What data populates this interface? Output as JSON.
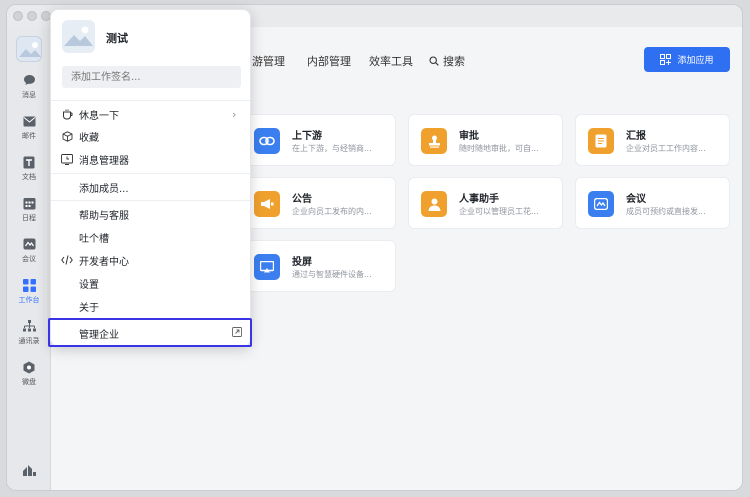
{
  "sidebar": {
    "items": [
      {
        "label": "消息",
        "icon": "chat-icon"
      },
      {
        "label": "邮件",
        "icon": "mail-icon"
      },
      {
        "label": "文档",
        "icon": "doc-icon"
      },
      {
        "label": "日程",
        "icon": "calendar-icon"
      },
      {
        "label": "会议",
        "icon": "meeting-icon"
      },
      {
        "label": "工作台",
        "icon": "workbench-icon"
      },
      {
        "label": "通讯录",
        "icon": "contacts-icon"
      },
      {
        "label": "微盘",
        "icon": "drive-icon"
      }
    ]
  },
  "tabs": {
    "t1": "游管理",
    "t2": "内部管理",
    "t3": "效率工具",
    "t4": "搜索"
  },
  "add_app_label": "添加应用",
  "cards": [
    {
      "title": "上下游",
      "desc": "在上下游，与经销商...",
      "color": "#3a7ef0"
    },
    {
      "title": "审批",
      "desc": "随时随地审批，可自...",
      "color": "#f0a12d"
    },
    {
      "title": "汇报",
      "desc": "企业对员工工作内容...",
      "color": "#f0a12d"
    },
    {
      "title": "公告",
      "desc": "企业向员工发布的内...",
      "color": "#f0a12d"
    },
    {
      "title": "人事助手",
      "desc": "企业可以管理员工花...",
      "color": "#f0a12d"
    },
    {
      "title": "会议",
      "desc": "成员可预约或直接发...",
      "color": "#3a7ef0"
    },
    {
      "title": "投屏",
      "desc": "通过与智慧硬件设备...",
      "color": "#3a7ef0"
    }
  ],
  "menu": {
    "name": "测试",
    "signature_placeholder": "添加工作签名...",
    "items": [
      {
        "label": "休息一下"
      },
      {
        "label": "收藏"
      },
      {
        "label": "消息管理器"
      },
      {
        "label": "添加成员..."
      },
      {
        "label": "帮助与客服"
      },
      {
        "label": "吐个槽"
      },
      {
        "label": "开发者中心"
      },
      {
        "label": "设置"
      },
      {
        "label": "关于"
      },
      {
        "label": "管理企业"
      }
    ]
  },
  "colors": {
    "accent": "#2f6ff2",
    "highlight": "#3b33e6"
  }
}
